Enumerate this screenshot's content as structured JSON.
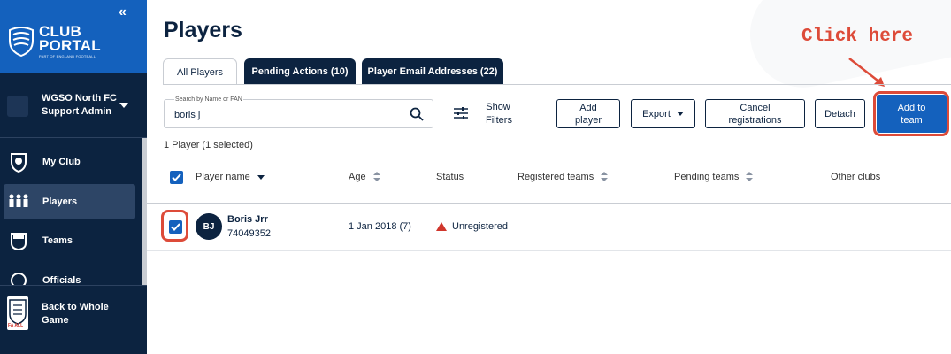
{
  "sidebar": {
    "logo": {
      "line1": "CLUB",
      "line2": "PORTAL",
      "tagline": "PART OF ENGLAND FOOTBALL"
    },
    "collapse_glyph": "«",
    "club": {
      "name": "WGSO North FC",
      "role": "Support Admin"
    },
    "items": [
      {
        "label": "My Club",
        "icon": "shield-icon"
      },
      {
        "label": "Players",
        "icon": "players-icon",
        "active": true
      },
      {
        "label": "Teams",
        "icon": "shirt-icon"
      },
      {
        "label": "Officials",
        "icon": "officials-icon"
      }
    ],
    "back": {
      "label": "Back to Whole Game",
      "icon": "fa-crest-icon",
      "crest_text": "FA ALL"
    }
  },
  "main": {
    "title": "Players",
    "tabs": [
      {
        "label": "All Players",
        "active": true
      },
      {
        "label": "Pending Actions (10)"
      },
      {
        "label": "Player Email Addresses (22)"
      }
    ],
    "search": {
      "caption": "Search by Name or FAN",
      "value": "boris j"
    },
    "filters_label": "Show Filters",
    "buttons": {
      "add_player": "Add player",
      "export": "Export",
      "cancel_registrations": "Cancel registrations",
      "detach": "Detach",
      "add_to_team": "Add to team"
    },
    "count_text": "1 Player (1 selected)",
    "columns": [
      "Player name",
      "Age",
      "Status",
      "Registered teams",
      "Pending teams",
      "Other clubs"
    ],
    "rows": [
      {
        "initials": "BJ",
        "name": "Boris Jrr",
        "fan": "74049352",
        "age": "1 Jan 2018 (7)",
        "status": "Unregistered",
        "registered_teams": "",
        "pending_teams": "",
        "other_clubs": "",
        "selected": true
      }
    ]
  },
  "annotation": {
    "text": "Click here",
    "color": "#dd4b39"
  },
  "colors": {
    "navy": "#0c2340",
    "brand_blue": "#1461bd",
    "annotation_red": "#dd4b39",
    "status_red": "#d0362c"
  }
}
